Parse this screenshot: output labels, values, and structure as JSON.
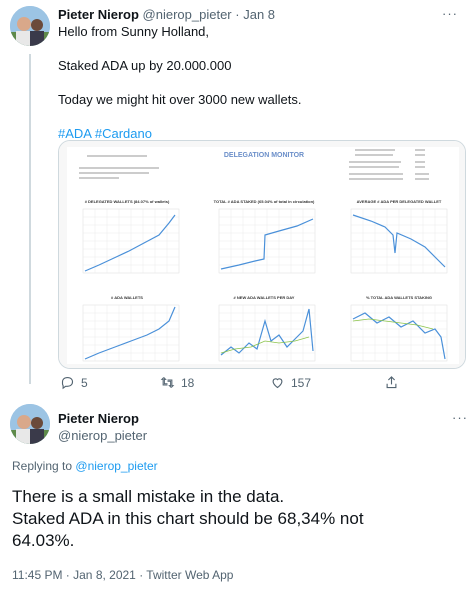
{
  "tweet": {
    "author_name": "Pieter Nierop",
    "author_handle": "@nierop_pieter",
    "separator": "·",
    "date": "Jan 8",
    "more_label": "···",
    "lines": [
      "Hello from Sunny Holland,",
      "Staked ADA up by 20.000.000",
      "Today we might hit over 3000 new wallets."
    ],
    "hashtags": [
      "#ADA",
      "#Cardano"
    ],
    "actions": {
      "replies": "5",
      "retweets": "18",
      "likes": "157"
    }
  },
  "media": {
    "title": "DELEGATION MONITOR",
    "charts": [
      "# DELEGATED WALLETS (84.07% of wallets)",
      "TOTAL # ADA STAKED (65.04% of total in circulation)",
      "AVERAGE # ADA PER DELEGATED WALLET",
      "# ADA WALLETS",
      "# NEW ADA WALLETS PER DAY",
      "% TOTAL ADA WALLETS STAKING"
    ]
  },
  "reply": {
    "author_name": "Pieter Nierop",
    "author_handle": "@nierop_pieter",
    "more_label": "···",
    "replying_prefix": "Replying to",
    "replying_to": "@nierop_pieter",
    "text_lines": [
      "There is a small mistake in the data.",
      "Staked ADA in this chart should be 68,34% not",
      "64.03%."
    ],
    "meta": "11:45 PM · Jan 8, 2021 · Twitter Web App"
  },
  "colors": {
    "accent": "#1d9bf0",
    "muted": "#536471",
    "chart_line": "#4a90d9",
    "chart_title": "#6b8fc9"
  },
  "icons": [
    "reply-icon",
    "retweet-icon",
    "like-icon",
    "share-icon",
    "more-icon"
  ]
}
